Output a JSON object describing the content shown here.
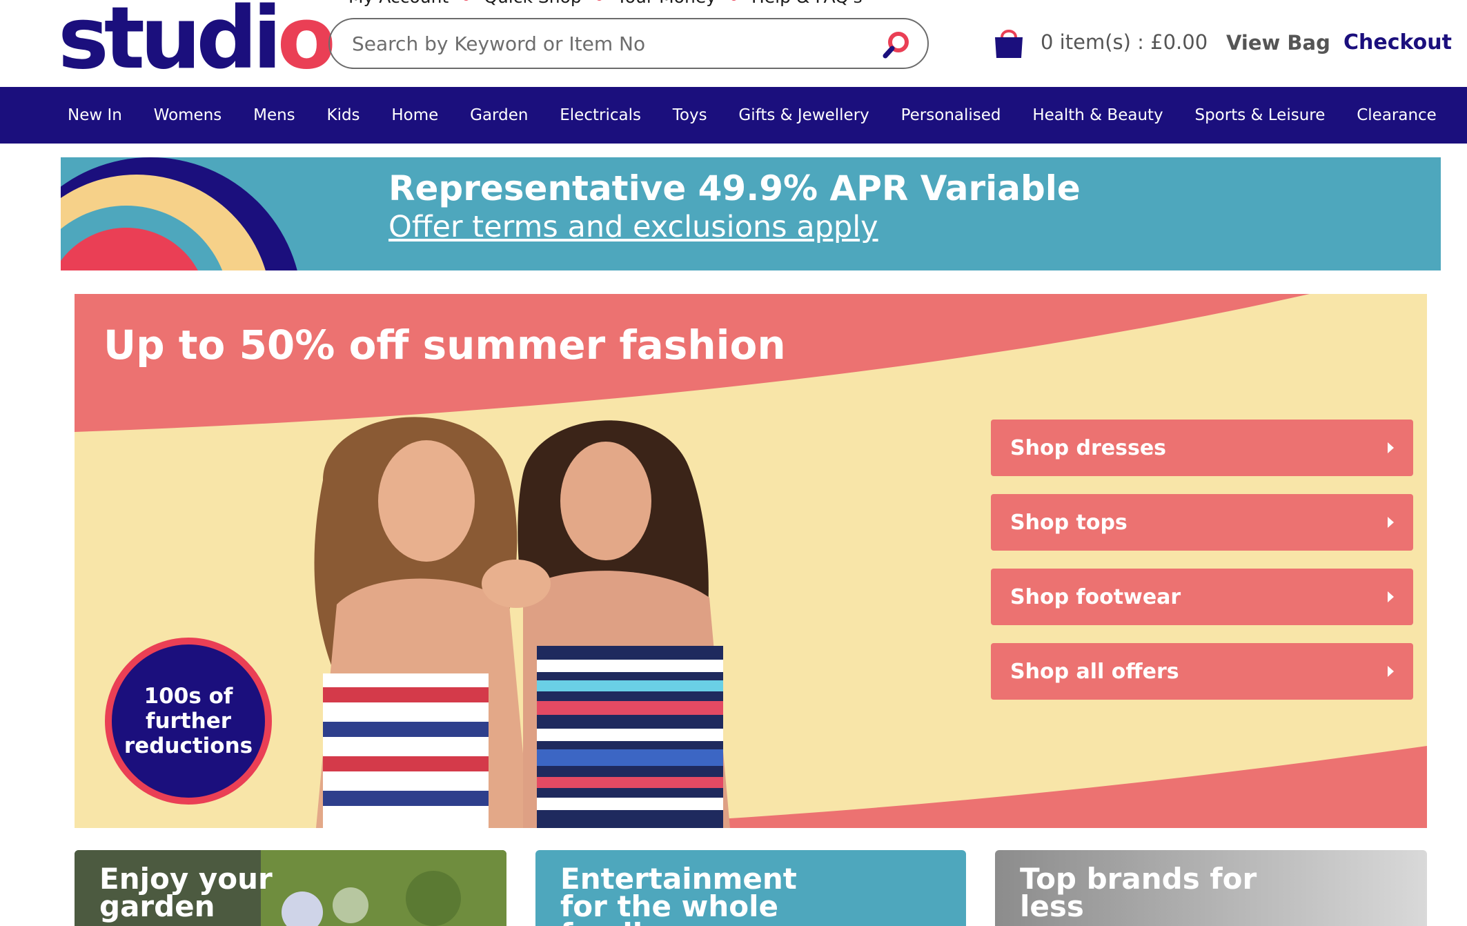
{
  "header": {
    "logo_text": "studi",
    "logo_o": "o",
    "top_links": [
      "My Account",
      "Quick Shop",
      "Your Money",
      "Help & FAQ's"
    ],
    "search_placeholder": "Search by Keyword or Item No",
    "cart_count": "0 item(s) : £0.00",
    "view_bag_label": "View Bag",
    "checkout_label": "Checkout"
  },
  "nav": {
    "items": [
      "New In",
      "Womens",
      "Mens",
      "Kids",
      "Home",
      "Garden",
      "Electricals",
      "Toys",
      "Gifts & Jewellery",
      "Personalised",
      "Health & Beauty",
      "Sports & Leisure",
      "Clearance"
    ]
  },
  "apr_banner": {
    "title": "Representative 49.9% APR Variable",
    "link": "Offer terms and exclusions apply"
  },
  "hero": {
    "title": "Up to 50% off summer fashion",
    "buttons": [
      "Shop dresses",
      "Shop tops",
      "Shop footwear",
      "Shop all offers"
    ],
    "badge": "100s of further reductions"
  },
  "cards": [
    {
      "title": "Enjoy your garden"
    },
    {
      "title": "Entertainment for the whole family"
    },
    {
      "title": "Top brands for less"
    }
  ],
  "colors": {
    "brand_navy": "#1b0f7d",
    "brand_red": "#ea3f55",
    "banner_teal": "#4ea7bd",
    "hero_coral": "#ec7271",
    "hero_cream": "#f8e5a8"
  }
}
